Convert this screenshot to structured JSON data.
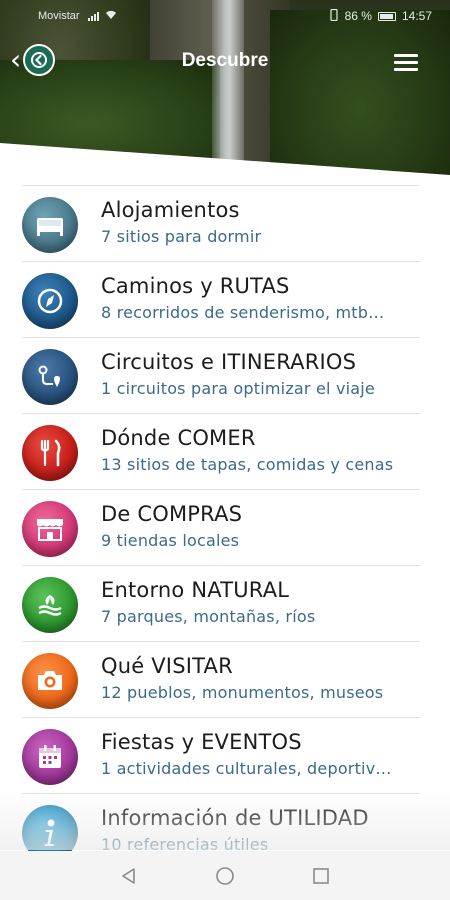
{
  "status_bar": {
    "carrier": "Movistar",
    "battery": "86 %",
    "time": "14:57"
  },
  "app_bar": {
    "title": "Descubre",
    "back_icon": "chevron-left-icon",
    "menu_icon": "hamburger-menu-icon"
  },
  "categories": [
    {
      "title": "Alojamientos",
      "subtitle": "7 sitios para dormir",
      "icon": "bed-icon",
      "color": "#4b7a8c"
    },
    {
      "title": "Caminos y RUTAS",
      "subtitle": "8 recorridos de senderismo, mtb…",
      "icon": "compass-icon",
      "color": "#1f5a8c"
    },
    {
      "title": "Circuitos e ITINERARIOS",
      "subtitle": "1 circuitos para optimizar el viaje",
      "icon": "route-icon",
      "color": "#2a5480"
    },
    {
      "title": "Dónde COMER",
      "subtitle": "13 sitios de tapas, comidas y cenas",
      "icon": "cutlery-icon",
      "color": "#c8201c"
    },
    {
      "title": "De COMPRAS",
      "subtitle": "9 tiendas locales",
      "icon": "shop-icon",
      "color": "#d63a78"
    },
    {
      "title": "Entorno NATURAL",
      "subtitle": "7 parques, montañas, ríos",
      "icon": "nature-icon",
      "color": "#2e9a30"
    },
    {
      "title": "Qué VISITAR",
      "subtitle": "12 pueblos, monumentos, museos",
      "icon": "camera-icon",
      "color": "#f06a1a"
    },
    {
      "title": "Fiestas y EVENTOS",
      "subtitle": "1 actividades culturales, deportiv…",
      "icon": "calendar-icon",
      "color": "#a33a9c"
    },
    {
      "title": "Información de UTILIDAD",
      "subtitle": "10 referencias útiles",
      "icon": "info-icon",
      "color": "#1d8ab8"
    }
  ],
  "nav_bar": {
    "back": "triangle-back-icon",
    "home": "circle-home-icon",
    "recents": "square-recents-icon"
  }
}
